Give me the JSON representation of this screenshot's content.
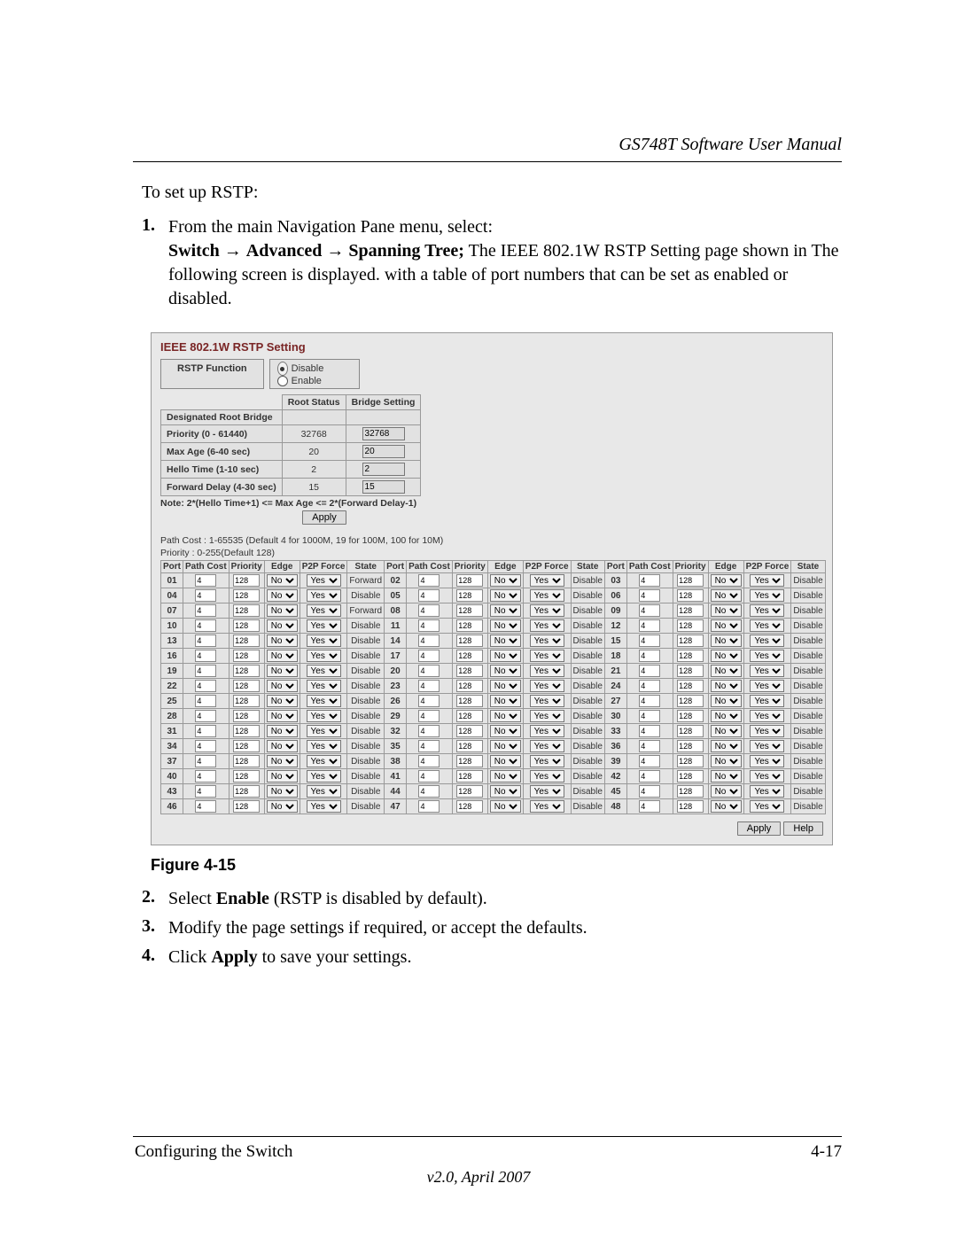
{
  "header": {
    "manual_title": "GS748T Software User Manual"
  },
  "intro": "To set up RSTP:",
  "steps": [
    {
      "num": "1.",
      "html": "From the main Navigation Pane menu, select:<br><b>Switch</b> <span class=\"arrow\">&rarr;</span> <b>Advanced</b> <span class=\"arrow\">&rarr;</span> <b>Spanning Tree;</b> The IEEE 802.1W RSTP Setting page shown in The following screen is displayed. with a table of port numbers that can be set as enabled or disabled."
    },
    {
      "num": "2.",
      "html": "Select <b>Enable</b> (RSTP is disabled by default)."
    },
    {
      "num": "3.",
      "html": "Modify the page settings if required, or accept the defaults."
    },
    {
      "num": "4.",
      "html": "Click <b>Apply</b> to save your settings."
    }
  ],
  "figure_caption": "Figure 4-15",
  "rstp": {
    "title": "IEEE 802.1W RSTP Setting",
    "function_label": "RSTP Function",
    "radio_disable": "Disable",
    "radio_enable": "Enable",
    "radio_selected": "Disable",
    "bridge_headers": {
      "root": "Root Status",
      "bridge": "Bridge Setting"
    },
    "bridge_rows": [
      {
        "label": "Designated Root Bridge",
        "root": "",
        "bridge": ""
      },
      {
        "label": "Priority (0 - 61440)",
        "root": "32768",
        "bridge": "32768"
      },
      {
        "label": "Max Age (6-40 sec)",
        "root": "20",
        "bridge": "20"
      },
      {
        "label": "Hello Time (1-10 sec)",
        "root": "2",
        "bridge": "2"
      },
      {
        "label": "Forward Delay (4-30 sec)",
        "root": "15",
        "bridge": "15"
      }
    ],
    "note": "Note: 2*(Hello Time+1) <= Max Age <= 2*(Forward Delay-1)",
    "apply_top": "Apply",
    "helper1": "Path Cost : 1-65535 (Default 4 for 1000M, 19 for 100M, 100 for 10M)",
    "helper2": "Priority : 0-255(Default 128)",
    "port_headers": [
      "Port",
      "Path Cost",
      "Priority",
      "Edge",
      "P2P Force",
      "State"
    ],
    "ports_col1": [
      {
        "p": "01",
        "pc": "4",
        "pr": "128",
        "e": "No",
        "p2": "Yes",
        "s": "Forward"
      },
      {
        "p": "04",
        "pc": "4",
        "pr": "128",
        "e": "No",
        "p2": "Yes",
        "s": "Disable"
      },
      {
        "p": "07",
        "pc": "4",
        "pr": "128",
        "e": "No",
        "p2": "Yes",
        "s": "Forward"
      },
      {
        "p": "10",
        "pc": "4",
        "pr": "128",
        "e": "No",
        "p2": "Yes",
        "s": "Disable"
      },
      {
        "p": "13",
        "pc": "4",
        "pr": "128",
        "e": "No",
        "p2": "Yes",
        "s": "Disable"
      },
      {
        "p": "16",
        "pc": "4",
        "pr": "128",
        "e": "No",
        "p2": "Yes",
        "s": "Disable"
      },
      {
        "p": "19",
        "pc": "4",
        "pr": "128",
        "e": "No",
        "p2": "Yes",
        "s": "Disable"
      },
      {
        "p": "22",
        "pc": "4",
        "pr": "128",
        "e": "No",
        "p2": "Yes",
        "s": "Disable"
      },
      {
        "p": "25",
        "pc": "4",
        "pr": "128",
        "e": "No",
        "p2": "Yes",
        "s": "Disable"
      },
      {
        "p": "28",
        "pc": "4",
        "pr": "128",
        "e": "No",
        "p2": "Yes",
        "s": "Disable"
      },
      {
        "p": "31",
        "pc": "4",
        "pr": "128",
        "e": "No",
        "p2": "Yes",
        "s": "Disable"
      },
      {
        "p": "34",
        "pc": "4",
        "pr": "128",
        "e": "No",
        "p2": "Yes",
        "s": "Disable"
      },
      {
        "p": "37",
        "pc": "4",
        "pr": "128",
        "e": "No",
        "p2": "Yes",
        "s": "Disable"
      },
      {
        "p": "40",
        "pc": "4",
        "pr": "128",
        "e": "No",
        "p2": "Yes",
        "s": "Disable"
      },
      {
        "p": "43",
        "pc": "4",
        "pr": "128",
        "e": "No",
        "p2": "Yes",
        "s": "Disable"
      },
      {
        "p": "46",
        "pc": "4",
        "pr": "128",
        "e": "No",
        "p2": "Yes",
        "s": "Disable"
      }
    ],
    "ports_col2": [
      {
        "p": "02",
        "pc": "4",
        "pr": "128",
        "e": "No",
        "p2": "Yes",
        "s": "Disable"
      },
      {
        "p": "05",
        "pc": "4",
        "pr": "128",
        "e": "No",
        "p2": "Yes",
        "s": "Disable"
      },
      {
        "p": "08",
        "pc": "4",
        "pr": "128",
        "e": "No",
        "p2": "Yes",
        "s": "Disable"
      },
      {
        "p": "11",
        "pc": "4",
        "pr": "128",
        "e": "No",
        "p2": "Yes",
        "s": "Disable"
      },
      {
        "p": "14",
        "pc": "4",
        "pr": "128",
        "e": "No",
        "p2": "Yes",
        "s": "Disable"
      },
      {
        "p": "17",
        "pc": "4",
        "pr": "128",
        "e": "No",
        "p2": "Yes",
        "s": "Disable"
      },
      {
        "p": "20",
        "pc": "4",
        "pr": "128",
        "e": "No",
        "p2": "Yes",
        "s": "Disable"
      },
      {
        "p": "23",
        "pc": "4",
        "pr": "128",
        "e": "No",
        "p2": "Yes",
        "s": "Disable"
      },
      {
        "p": "26",
        "pc": "4",
        "pr": "128",
        "e": "No",
        "p2": "Yes",
        "s": "Disable"
      },
      {
        "p": "29",
        "pc": "4",
        "pr": "128",
        "e": "No",
        "p2": "Yes",
        "s": "Disable"
      },
      {
        "p": "32",
        "pc": "4",
        "pr": "128",
        "e": "No",
        "p2": "Yes",
        "s": "Disable"
      },
      {
        "p": "35",
        "pc": "4",
        "pr": "128",
        "e": "No",
        "p2": "Yes",
        "s": "Disable"
      },
      {
        "p": "38",
        "pc": "4",
        "pr": "128",
        "e": "No",
        "p2": "Yes",
        "s": "Disable"
      },
      {
        "p": "41",
        "pc": "4",
        "pr": "128",
        "e": "No",
        "p2": "Yes",
        "s": "Disable"
      },
      {
        "p": "44",
        "pc": "4",
        "pr": "128",
        "e": "No",
        "p2": "Yes",
        "s": "Disable"
      },
      {
        "p": "47",
        "pc": "4",
        "pr": "128",
        "e": "No",
        "p2": "Yes",
        "s": "Disable"
      }
    ],
    "ports_col3": [
      {
        "p": "03",
        "pc": "4",
        "pr": "128",
        "e": "No",
        "p2": "Yes",
        "s": "Disable"
      },
      {
        "p": "06",
        "pc": "4",
        "pr": "128",
        "e": "No",
        "p2": "Yes",
        "s": "Disable"
      },
      {
        "p": "09",
        "pc": "4",
        "pr": "128",
        "e": "No",
        "p2": "Yes",
        "s": "Disable"
      },
      {
        "p": "12",
        "pc": "4",
        "pr": "128",
        "e": "No",
        "p2": "Yes",
        "s": "Disable"
      },
      {
        "p": "15",
        "pc": "4",
        "pr": "128",
        "e": "No",
        "p2": "Yes",
        "s": "Disable"
      },
      {
        "p": "18",
        "pc": "4",
        "pr": "128",
        "e": "No",
        "p2": "Yes",
        "s": "Disable"
      },
      {
        "p": "21",
        "pc": "4",
        "pr": "128",
        "e": "No",
        "p2": "Yes",
        "s": "Disable"
      },
      {
        "p": "24",
        "pc": "4",
        "pr": "128",
        "e": "No",
        "p2": "Yes",
        "s": "Disable"
      },
      {
        "p": "27",
        "pc": "4",
        "pr": "128",
        "e": "No",
        "p2": "Yes",
        "s": "Disable"
      },
      {
        "p": "30",
        "pc": "4",
        "pr": "128",
        "e": "No",
        "p2": "Yes",
        "s": "Disable"
      },
      {
        "p": "33",
        "pc": "4",
        "pr": "128",
        "e": "No",
        "p2": "Yes",
        "s": "Disable"
      },
      {
        "p": "36",
        "pc": "4",
        "pr": "128",
        "e": "No",
        "p2": "Yes",
        "s": "Disable"
      },
      {
        "p": "39",
        "pc": "4",
        "pr": "128",
        "e": "No",
        "p2": "Yes",
        "s": "Disable"
      },
      {
        "p": "42",
        "pc": "4",
        "pr": "128",
        "e": "No",
        "p2": "Yes",
        "s": "Disable"
      },
      {
        "p": "45",
        "pc": "4",
        "pr": "128",
        "e": "No",
        "p2": "Yes",
        "s": "Disable"
      },
      {
        "p": "48",
        "pc": "4",
        "pr": "128",
        "e": "No",
        "p2": "Yes",
        "s": "Disable"
      }
    ],
    "apply_label": "Apply",
    "help_label": "Help"
  },
  "footer": {
    "left": "Configuring the Switch",
    "right": "4-17",
    "center": "v2.0, April 2007"
  }
}
